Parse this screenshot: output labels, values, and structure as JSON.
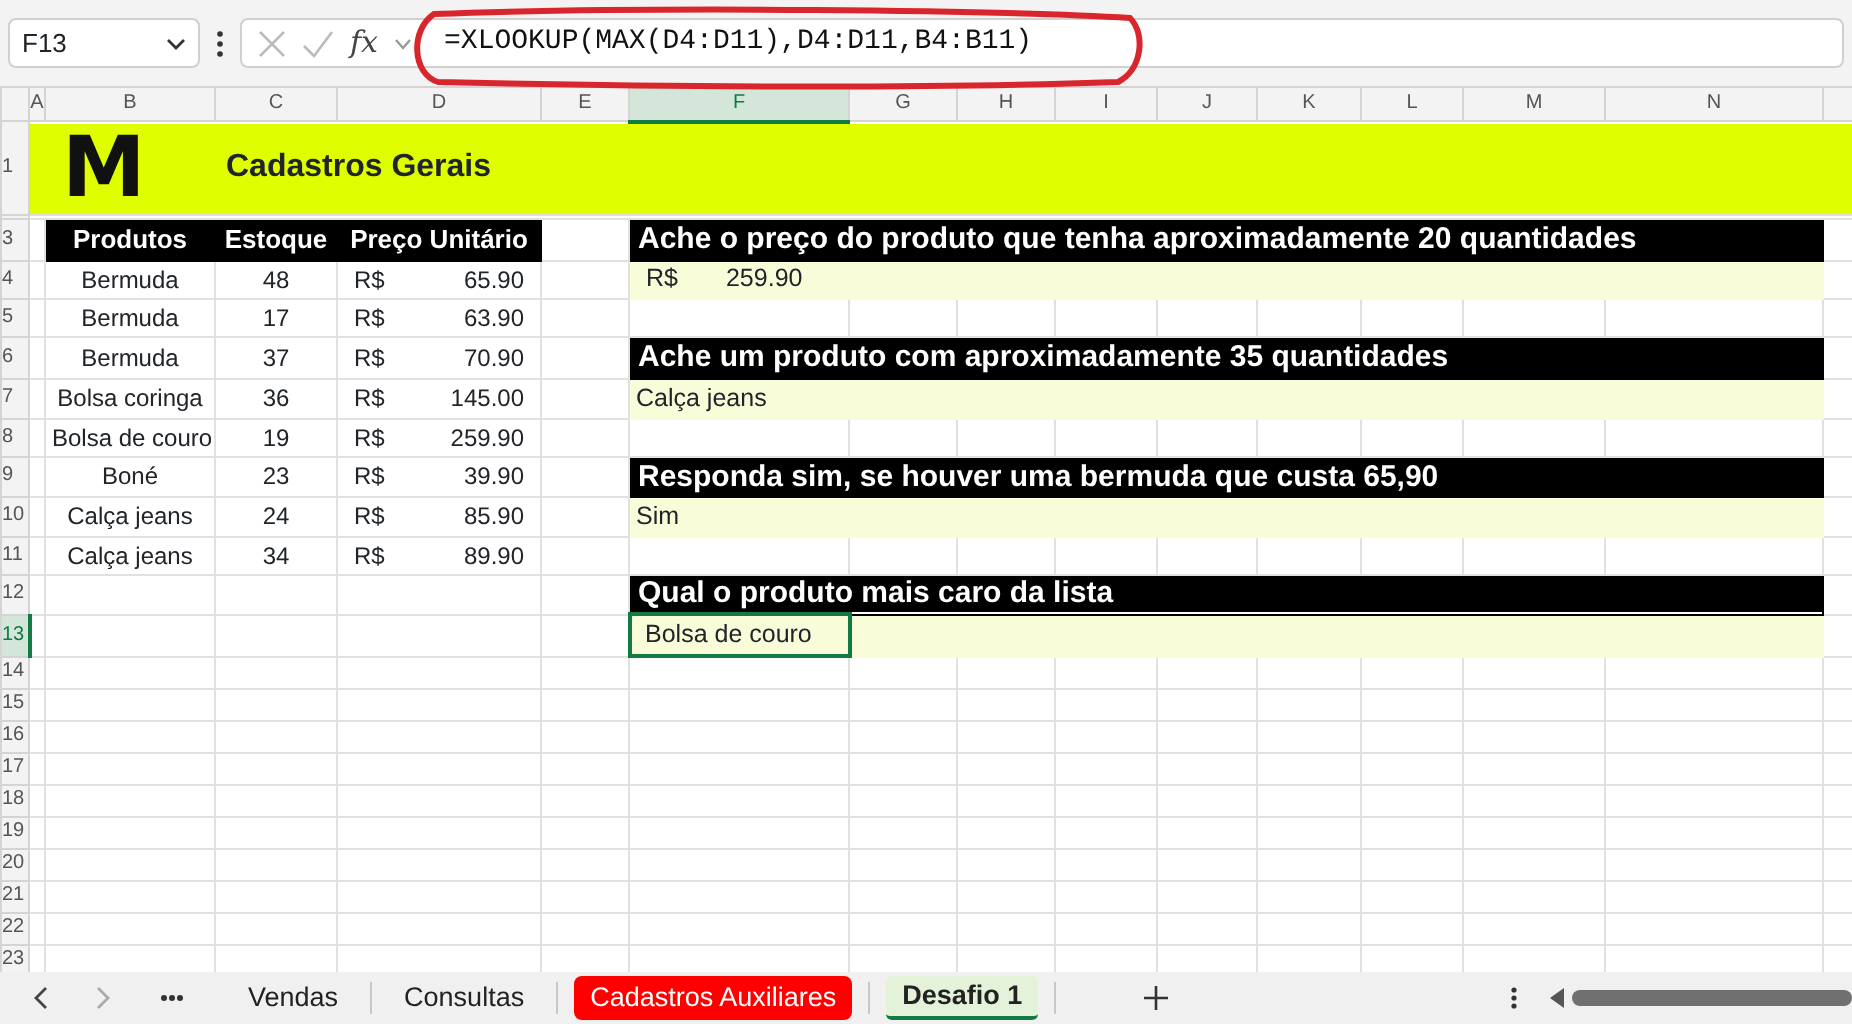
{
  "formula_bar": {
    "name_box": "F13",
    "function_label": "fx",
    "formula": "=XLOOKUP(MAX(D4:D11),D4:D11,B4:B11)"
  },
  "columns": [
    {
      "label": "A",
      "selected": false
    },
    {
      "label": "B",
      "selected": false
    },
    {
      "label": "C",
      "selected": false
    },
    {
      "label": "D",
      "selected": false
    },
    {
      "label": "E",
      "selected": false
    },
    {
      "label": "F",
      "selected": true
    },
    {
      "label": "G",
      "selected": false
    },
    {
      "label": "H",
      "selected": false
    },
    {
      "label": "I",
      "selected": false
    },
    {
      "label": "J",
      "selected": false
    },
    {
      "label": "K",
      "selected": false
    },
    {
      "label": "L",
      "selected": false
    },
    {
      "label": "M",
      "selected": false
    },
    {
      "label": "N",
      "selected": false
    }
  ],
  "row_headers": [
    {
      "label": "1",
      "selected": false
    },
    {
      "label": "3",
      "selected": false
    },
    {
      "label": "4",
      "selected": false
    },
    {
      "label": "5",
      "selected": false
    },
    {
      "label": "6",
      "selected": false
    },
    {
      "label": "7",
      "selected": false
    },
    {
      "label": "8",
      "selected": false
    },
    {
      "label": "9",
      "selected": false
    },
    {
      "label": "10",
      "selected": false
    },
    {
      "label": "11",
      "selected": false
    },
    {
      "label": "12",
      "selected": false
    },
    {
      "label": "13",
      "selected": true
    },
    {
      "label": "14",
      "selected": false
    },
    {
      "label": "15",
      "selected": false
    },
    {
      "label": "16",
      "selected": false
    },
    {
      "label": "17",
      "selected": false
    },
    {
      "label": "18",
      "selected": false
    },
    {
      "label": "19",
      "selected": false
    },
    {
      "label": "20",
      "selected": false
    },
    {
      "label": "21",
      "selected": false
    },
    {
      "label": "22",
      "selected": false
    },
    {
      "label": "23",
      "selected": false
    }
  ],
  "banner": {
    "logo": "M",
    "title": "Cadastros Gerais"
  },
  "products": {
    "columns": [
      "Produtos",
      "Estoque",
      "Preço Unitário"
    ],
    "rows": [
      {
        "product": "Bermuda",
        "stock": "48",
        "currency": "R$",
        "price": "65.90"
      },
      {
        "product": "Bermuda",
        "stock": "17",
        "currency": "R$",
        "price": "63.90"
      },
      {
        "product": "Bermuda",
        "stock": "37",
        "currency": "R$",
        "price": "70.90"
      },
      {
        "product": "Bolsa coringa",
        "stock": "36",
        "currency": "R$",
        "price": "145.00"
      },
      {
        "product": "Bolsa de couro",
        "stock": "19",
        "currency": "R$",
        "price": "259.90"
      },
      {
        "product": "Boné",
        "stock": "23",
        "currency": "R$",
        "price": "39.90"
      },
      {
        "product": "Calça jeans",
        "stock": "24",
        "currency": "R$",
        "price": "85.90"
      },
      {
        "product": "Calça jeans",
        "stock": "34",
        "currency": "R$",
        "price": "89.90"
      }
    ]
  },
  "questions": [
    {
      "question": "Ache o preço do produto que tenha aproximadamente 20 quantidades",
      "answer": {
        "currency": "R$",
        "value": "259.90"
      },
      "selected": false
    },
    {
      "question": "Ache um produto com aproximadamente 35 quantidades",
      "answer": {
        "value": "Calça jeans"
      },
      "selected": false
    },
    {
      "question": "Responda sim, se houver uma bermuda que custa 65,90",
      "answer": {
        "value": "Sim"
      },
      "selected": false
    },
    {
      "question": "Qual o produto mais caro da lista",
      "answer": {
        "value": "Bolsa de couro"
      },
      "selected": true
    }
  ],
  "sheet_tabs": [
    {
      "label": "Vendas",
      "selected": false
    },
    {
      "label": "Consultas",
      "selected": false
    },
    {
      "label": "Cadastros Auxiliares",
      "selected": false,
      "color": "#ff0000"
    },
    {
      "label": "Desafio 1",
      "selected": true
    }
  ]
}
